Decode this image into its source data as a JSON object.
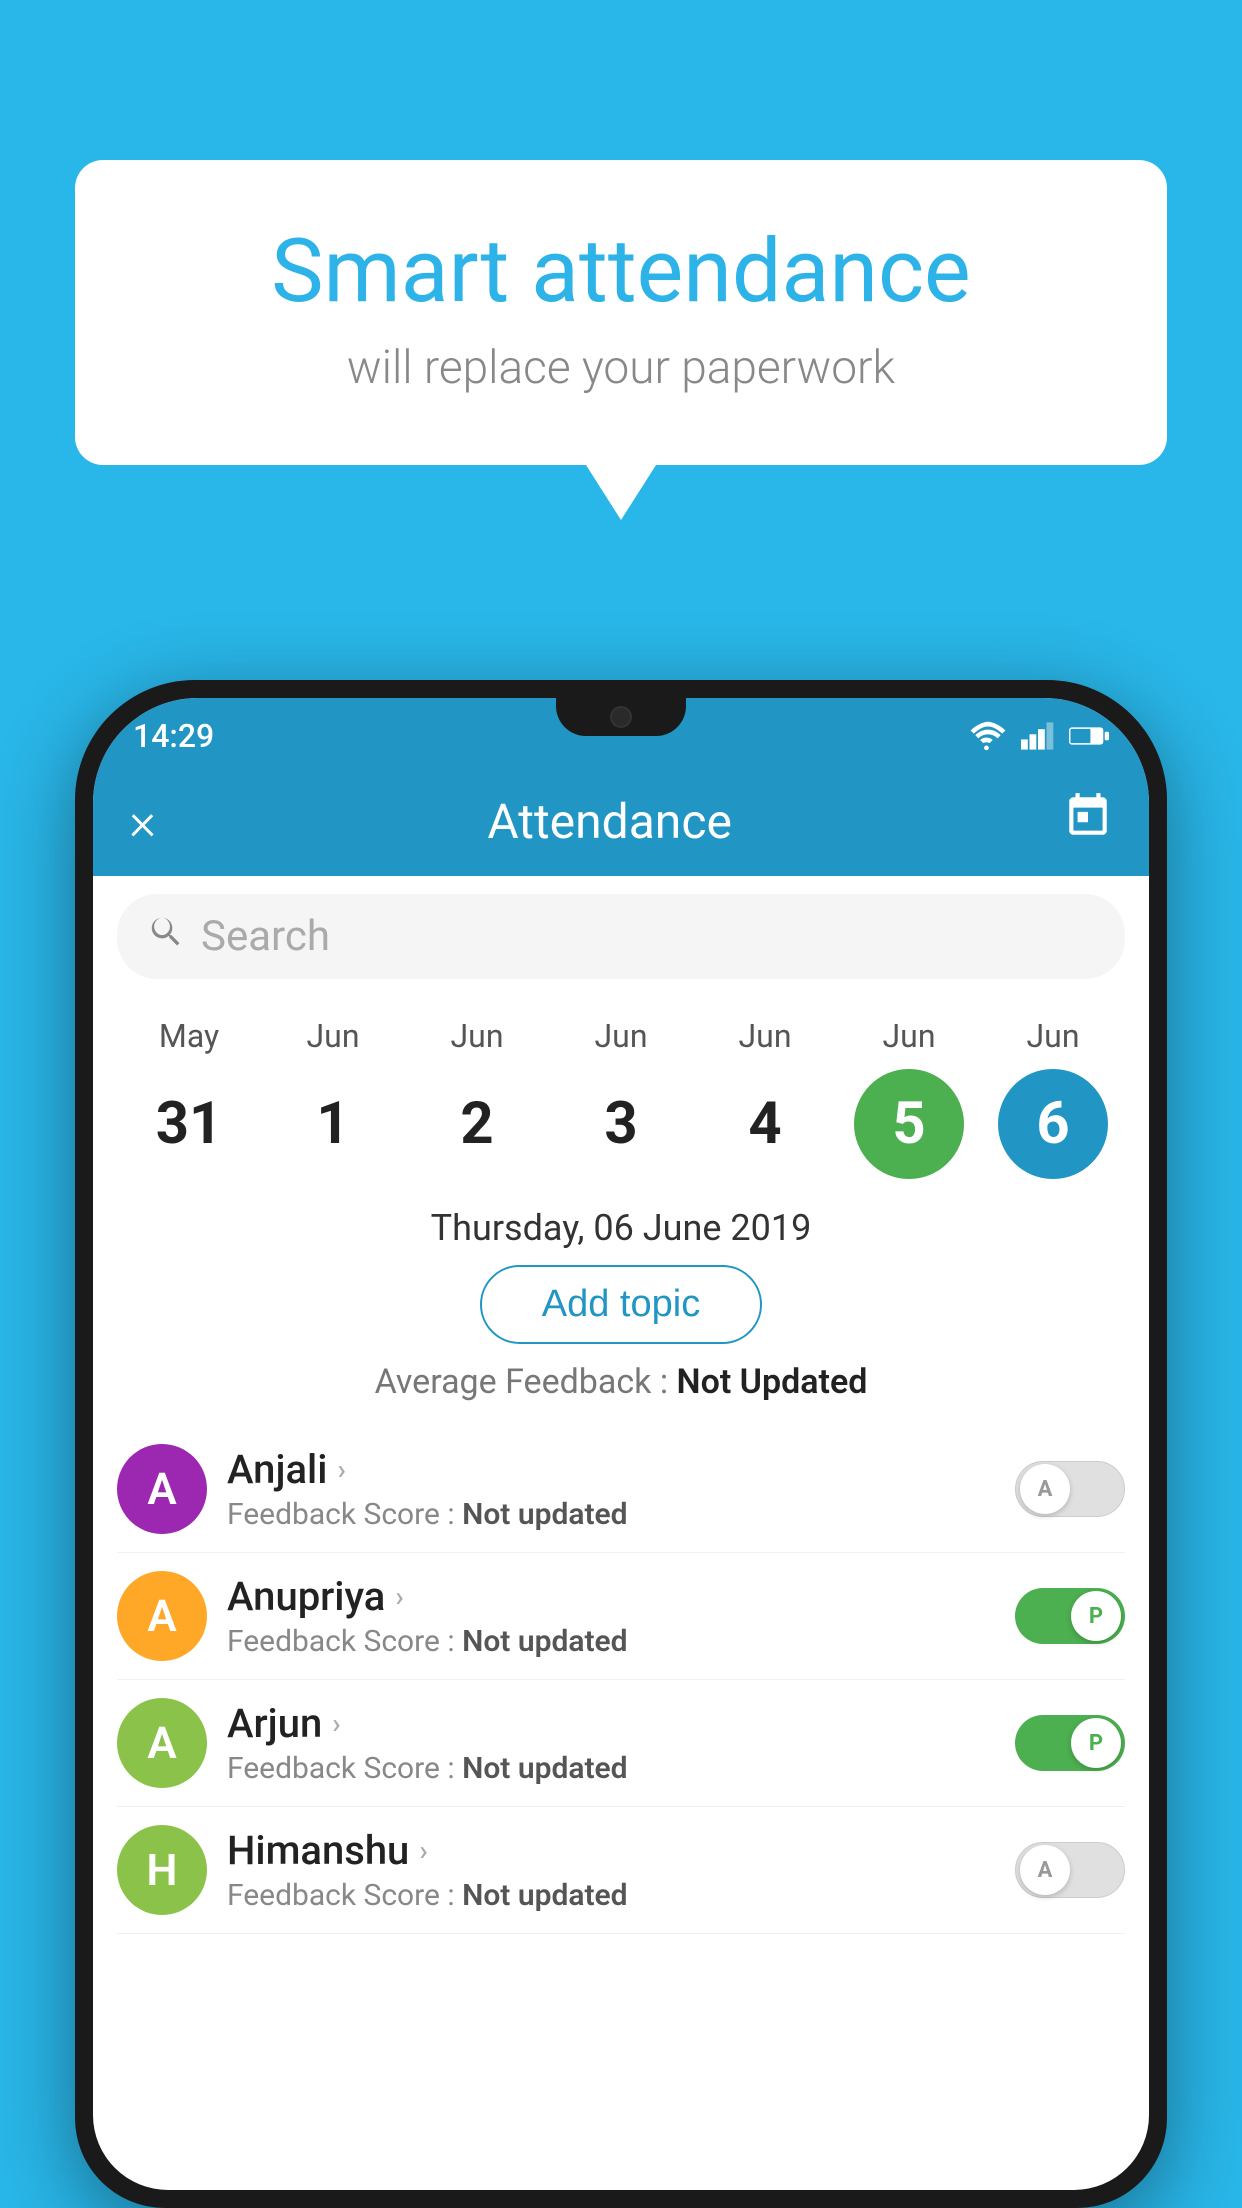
{
  "background_color": "#29b6e8",
  "bubble": {
    "title": "Smart attendance",
    "subtitle": "will replace your paperwork"
  },
  "status_bar": {
    "time": "14:29"
  },
  "app_bar": {
    "title": "Attendance",
    "close_label": "×"
  },
  "search": {
    "placeholder": "Search"
  },
  "calendar": {
    "columns": [
      {
        "month": "May",
        "day": "31",
        "style": "normal"
      },
      {
        "month": "Jun",
        "day": "1",
        "style": "normal"
      },
      {
        "month": "Jun",
        "day": "2",
        "style": "normal"
      },
      {
        "month": "Jun",
        "day": "3",
        "style": "normal"
      },
      {
        "month": "Jun",
        "day": "4",
        "style": "normal"
      },
      {
        "month": "Jun",
        "day": "5",
        "style": "green"
      },
      {
        "month": "Jun",
        "day": "6",
        "style": "blue"
      }
    ]
  },
  "selected_date": "Thursday, 06 June 2019",
  "add_topic_label": "Add topic",
  "avg_feedback_label": "Average Feedback :",
  "avg_feedback_value": "Not Updated",
  "students": [
    {
      "name": "Anjali",
      "avatar_letter": "A",
      "avatar_color": "#9c27b0",
      "feedback_label": "Feedback Score :",
      "feedback_value": "Not updated",
      "toggle": "off",
      "toggle_letter": "A"
    },
    {
      "name": "Anupriya",
      "avatar_letter": "A",
      "avatar_color": "#ffa726",
      "feedback_label": "Feedback Score :",
      "feedback_value": "Not updated",
      "toggle": "on",
      "toggle_letter": "P"
    },
    {
      "name": "Arjun",
      "avatar_letter": "A",
      "avatar_color": "#8bc34a",
      "feedback_label": "Feedback Score :",
      "feedback_value": "Not updated",
      "toggle": "on",
      "toggle_letter": "P"
    },
    {
      "name": "Himanshu",
      "avatar_letter": "H",
      "avatar_color": "#8bc34a",
      "feedback_label": "Feedback Score :",
      "feedback_value": "Not updated",
      "toggle": "off",
      "toggle_letter": "A"
    }
  ]
}
